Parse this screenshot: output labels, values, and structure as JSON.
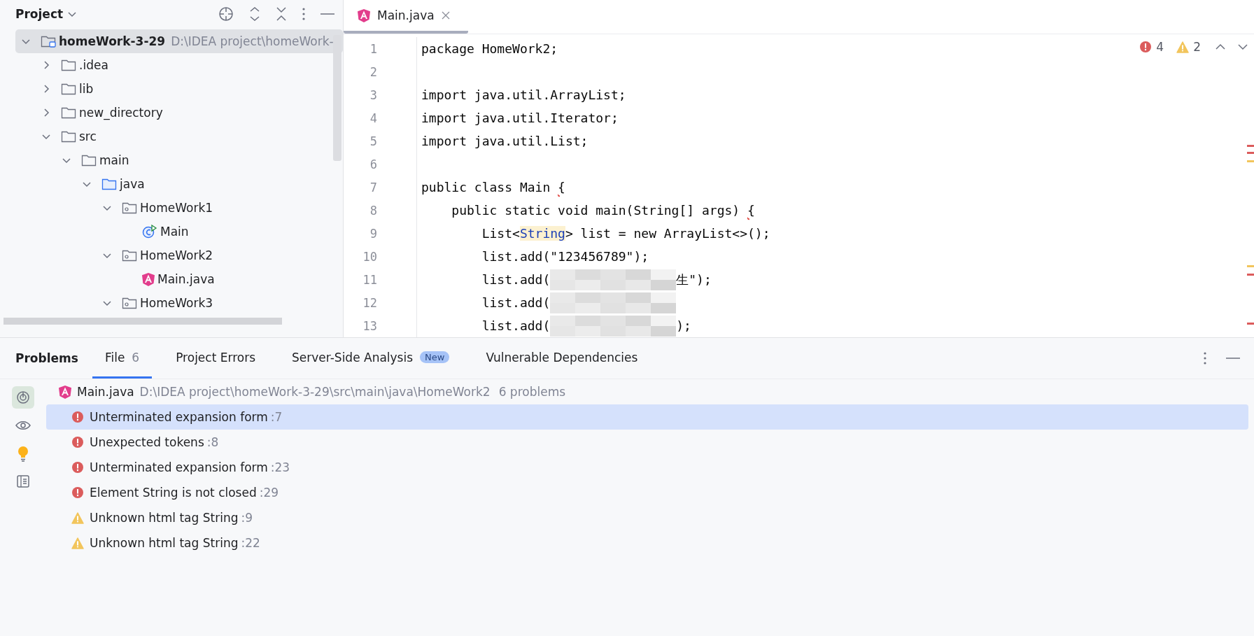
{
  "project_panel": {
    "title": "Project",
    "tree": [
      {
        "label": "homeWork-3-29",
        "path": "D:\\IDEA project\\homeWork-",
        "kind": "module",
        "expanded": true,
        "selected": true,
        "children": [
          {
            "label": ".idea",
            "kind": "folder",
            "expanded": false,
            "selected": false
          },
          {
            "label": "lib",
            "kind": "folder",
            "expanded": false,
            "selected": false
          },
          {
            "label": "new_directory",
            "kind": "folder",
            "expanded": false,
            "selected": false
          },
          {
            "label": "src",
            "kind": "folder",
            "expanded": true,
            "selected": false,
            "children": [
              {
                "label": "main",
                "kind": "folder",
                "expanded": true,
                "selected": false,
                "children": [
                  {
                    "label": "java",
                    "kind": "source",
                    "expanded": true,
                    "selected": false,
                    "children": [
                      {
                        "label": "HomeWork1",
                        "kind": "package",
                        "expanded": true,
                        "selected": false,
                        "children": [
                          {
                            "label": "Main",
                            "kind": "class",
                            "selected": false
                          }
                        ]
                      },
                      {
                        "label": "HomeWork2",
                        "kind": "package",
                        "expanded": true,
                        "selected": false,
                        "children": [
                          {
                            "label": "Main.java",
                            "kind": "angular",
                            "selected": false
                          }
                        ]
                      },
                      {
                        "label": "HomeWork3",
                        "kind": "package",
                        "expanded": true,
                        "selected": false
                      }
                    ]
                  }
                ]
              }
            ]
          }
        ]
      }
    ]
  },
  "editor": {
    "tabs": [
      {
        "label": "Main.java",
        "selected": true
      }
    ],
    "errors": "4",
    "warnings": "2",
    "lines": [
      {
        "number": "1",
        "segments": [
          {
            "text": "package HomeWork2;",
            "kind": "plain"
          }
        ]
      },
      {
        "number": "2"
      },
      {
        "number": "3",
        "segments": [
          {
            "text": "import java.util.ArrayList;",
            "kind": "plain"
          }
        ]
      },
      {
        "number": "4",
        "segments": [
          {
            "text": "import java.util.Iterator;",
            "kind": "plain"
          }
        ]
      },
      {
        "number": "5",
        "segments": [
          {
            "text": "import java.util.List;",
            "kind": "plain"
          }
        ]
      },
      {
        "number": "6"
      },
      {
        "number": "7",
        "segments": [
          {
            "text": "public class Main ",
            "kind": "plain"
          },
          {
            "text": "{",
            "kind": "error"
          }
        ]
      },
      {
        "number": "8",
        "segments": [
          {
            "text": "    public static void main(String[] args) ",
            "kind": "plain"
          },
          {
            "text": "{",
            "kind": "error"
          }
        ]
      },
      {
        "number": "9",
        "segments": [
          {
            "text": "        List<",
            "kind": "plain"
          },
          {
            "text": "String",
            "kind": "type"
          },
          {
            "text": "> list = new ArrayList<>();",
            "kind": "plain"
          }
        ]
      },
      {
        "number": "10",
        "segments": [
          {
            "text": "        list.add(\"123456789\");",
            "kind": "plain"
          }
        ]
      },
      {
        "number": "11",
        "segments": [
          {
            "text": "        list.add(",
            "kind": "plain"
          },
          {
            "kind": "redacted"
          },
          {
            "text": "生\");",
            "kind": "plain"
          }
        ]
      },
      {
        "number": "12",
        "segments": [
          {
            "text": "        list.add(",
            "kind": "plain"
          },
          {
            "kind": "redacted"
          }
        ]
      },
      {
        "number": "13",
        "segments": [
          {
            "text": "        list.add(",
            "kind": "plain"
          },
          {
            "kind": "redacted"
          },
          {
            "text": ");",
            "kind": "plain"
          }
        ]
      }
    ]
  },
  "problems_panel": {
    "title": "Problems",
    "tabs": [
      {
        "label": "File",
        "count": "6",
        "selected": true
      },
      {
        "label": "Project Errors",
        "selected": false
      },
      {
        "label": "Server-Side Analysis",
        "badge": "New",
        "selected": false
      },
      {
        "label": "Vulnerable Dependencies",
        "selected": false
      }
    ],
    "file": {
      "name": "Main.java",
      "path": "D:\\IDEA project\\homeWork-3-29\\src\\main\\java\\HomeWork2",
      "count": "6 problems"
    },
    "items": [
      {
        "kind": "error",
        "message": "Unterminated expansion form",
        "line": ":7",
        "selected": true
      },
      {
        "kind": "error",
        "message": "Unexpected tokens",
        "line": ":8",
        "selected": false
      },
      {
        "kind": "error",
        "message": "Unterminated expansion form",
        "line": ":23",
        "selected": false
      },
      {
        "kind": "error",
        "message": "Element String is not closed",
        "line": ":29",
        "selected": false
      },
      {
        "kind": "warning",
        "message": "Unknown html tag String",
        "line": ":9",
        "selected": false
      },
      {
        "kind": "warning",
        "message": "Unknown html tag String",
        "line": ":22",
        "selected": false
      }
    ]
  }
}
